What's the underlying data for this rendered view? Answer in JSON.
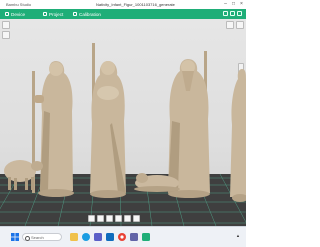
{
  "app": {
    "name": "Bambu Studio",
    "file_title": "Nativity_Infant_Figur_1001103716_generate"
  },
  "tabs": [
    {
      "label": "Device"
    },
    {
      "label": "Project"
    },
    {
      "label": "Calibration"
    }
  ],
  "taskbar": {
    "search_placeholder": "Search",
    "icons": [
      "windows-start-icon",
      "search-icon",
      "files-icon",
      "edge-icon",
      "store-icon",
      "mail-icon",
      "chrome-icon",
      "teams-icon",
      "bambu-icon"
    ]
  },
  "colors": {
    "toolbar": "#1fae78",
    "bed": "#3f3f3f",
    "grid": "#52a58b",
    "model": "#c9b79c"
  },
  "models": [
    {
      "name": "shepherd-with-staff-figure"
    },
    {
      "name": "shepherd-with-lamb-figure"
    },
    {
      "name": "bearded-man-with-staff-figure"
    },
    {
      "name": "robed-figure-partial"
    },
    {
      "name": "sheep-figure"
    },
    {
      "name": "lying-lamb-figure"
    }
  ]
}
